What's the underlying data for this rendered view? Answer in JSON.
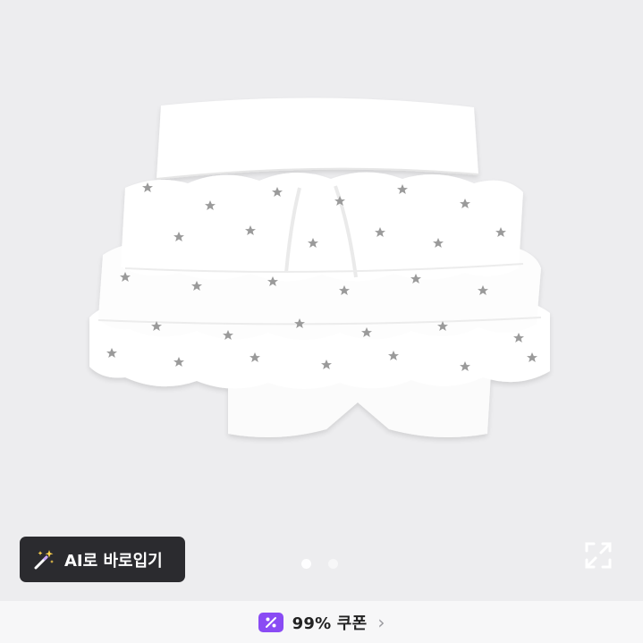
{
  "colors": {
    "page_bg": "#ededef",
    "button_bg": "#2b2b2f",
    "coupon_accent": "#8a4bf4",
    "coupon_bar_bg": "#f7f7f8"
  },
  "gallery": {
    "image_alt": "white star-print tiered ruffle skort",
    "current_index": 1,
    "total": 2
  },
  "ai_button": {
    "icon": "magic-wand-icon",
    "label": "AI로 바로입기"
  },
  "fullscreen": {
    "icon": "expand-icon"
  },
  "coupon": {
    "icon": "percent-coupon-icon",
    "label": "99% 쿠폰",
    "chevron": "›"
  }
}
